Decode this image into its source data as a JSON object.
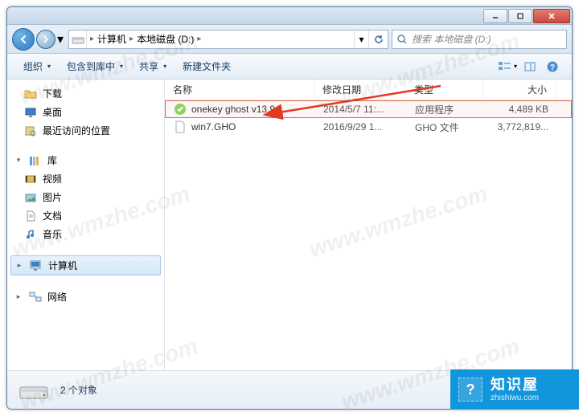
{
  "watermark": "www.wmzhe.com",
  "titlebar": {
    "min": "—",
    "max": "□",
    "close": "✕"
  },
  "nav": {
    "back_glyph": "◀",
    "fwd_glyph": "▶",
    "dd_glyph": "▾",
    "breadcrumb_sep": "▸",
    "segments": {
      "computer": "计算机",
      "drive": "本地磁盘 (D:)"
    },
    "refresh_glyph": "↻",
    "search_placeholder": "搜索 本地磁盘 (D:)"
  },
  "toolbar": {
    "organize": "组织",
    "include": "包含到库中",
    "share": "共享",
    "newfolder": "新建文件夹",
    "dd_glyph": "▾"
  },
  "sidebar": {
    "downloads": "下载",
    "desktop": "桌面",
    "recent": "最近访问的位置",
    "libraries": "库",
    "videos": "视频",
    "pictures": "图片",
    "documents": "文档",
    "music": "音乐",
    "computer": "计算机",
    "network": "网络"
  },
  "columns": {
    "name": "名称",
    "date": "修改日期",
    "type": "类型",
    "size": "大小"
  },
  "files": [
    {
      "name": "onekey ghost v13.9",
      "date": "2014/5/7 11:...",
      "type": "应用程序",
      "size": "4,489 KB"
    },
    {
      "name": "win7.GHO",
      "date": "2016/9/29 1...",
      "type": "GHO 文件",
      "size": "3,772,819..."
    }
  ],
  "status": {
    "count": "2 个对象"
  },
  "brand": {
    "main": "知识屋",
    "sub": "zhishiwu.com",
    "icon": "?"
  }
}
